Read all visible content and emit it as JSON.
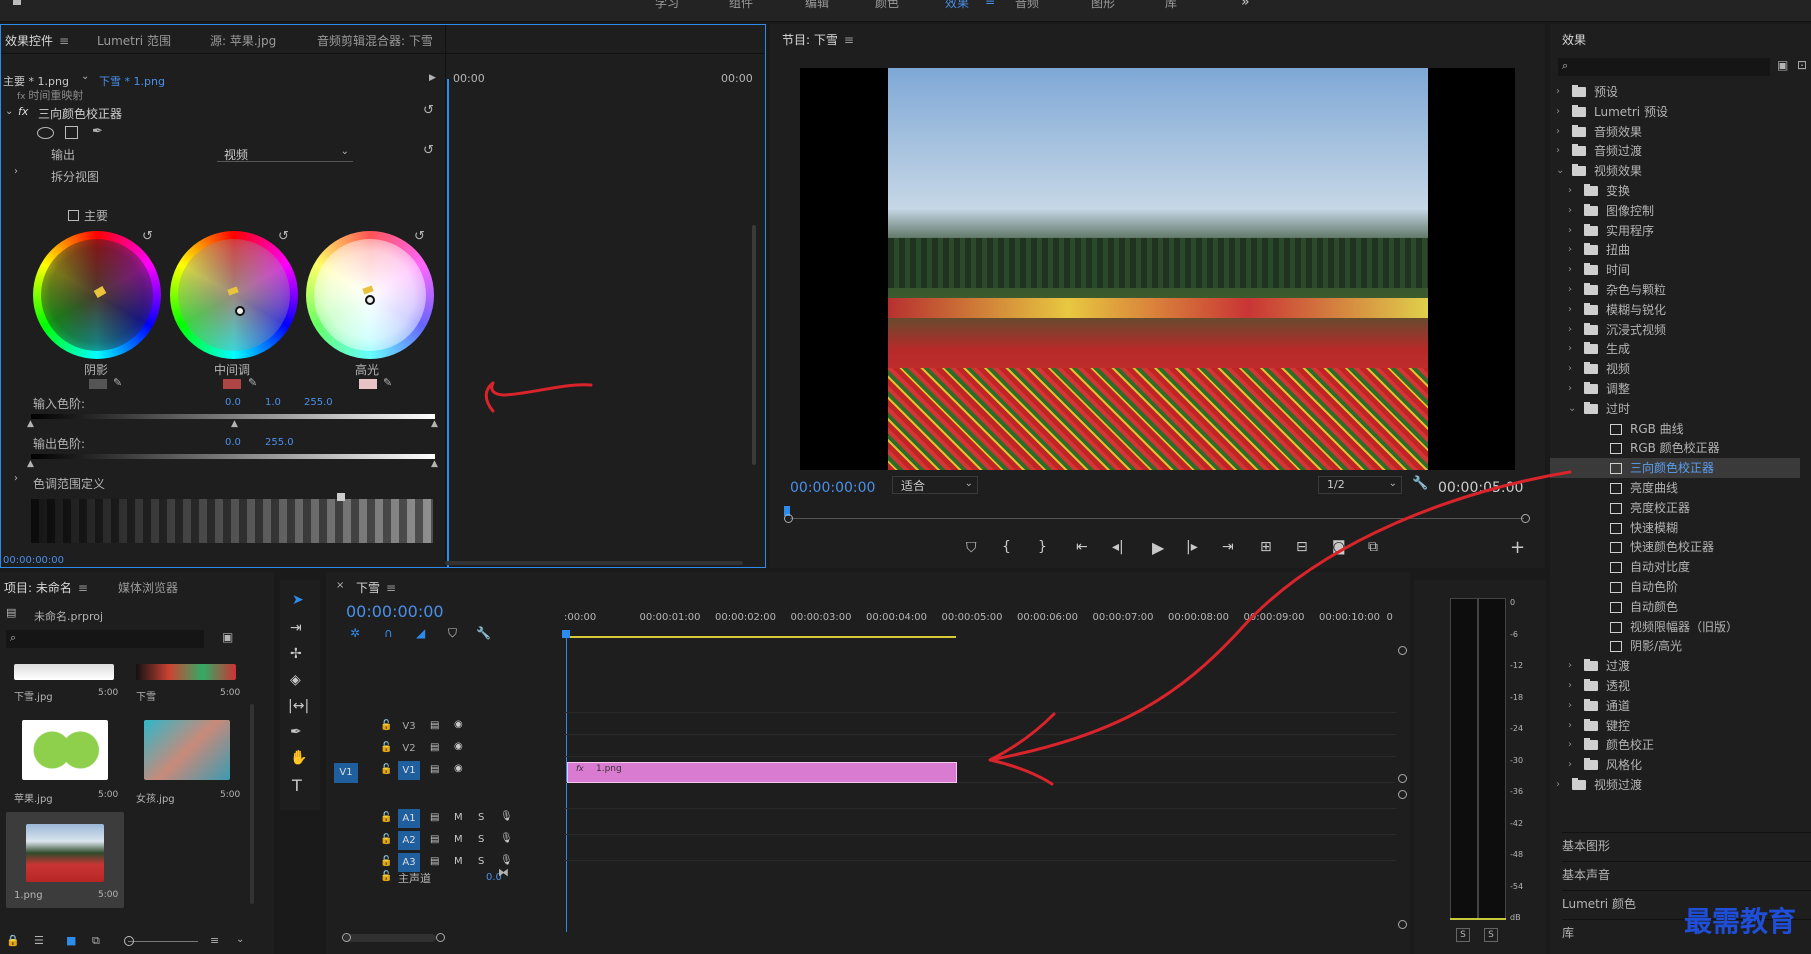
{
  "topbar": {
    "home_icon": "home-icon",
    "workspaces": [
      "学习",
      "组件",
      "编辑",
      "颜色",
      "效果",
      "音频",
      "图形",
      "库"
    ],
    "active_workspace": "效果",
    "more": "»"
  },
  "effect_controls": {
    "tabs": [
      "效果控件",
      "Lumetri 范围",
      "源: 苹果.jpg",
      "音频剪辑混合器: 下雪"
    ],
    "clip_master": "主要 * 1.png",
    "clip_seq": "下雪 * 1.png",
    "time_start": "00:00",
    "time_end": "00:00",
    "cut_row": "时间重映射",
    "effect_name": "三向颜色校正器",
    "output_label": "输出",
    "output_value": "视频",
    "split_view": "拆分视图",
    "master_checkbox": "主要",
    "wheels": [
      {
        "label": "阴影",
        "swatch": "#555555"
      },
      {
        "label": "中间调",
        "swatch": "#b04545"
      },
      {
        "label": "高光",
        "swatch": "#e8c4c4"
      }
    ],
    "input_levels_label": "输入色阶:",
    "input_levels": [
      "0.0",
      "1.0",
      "255.0"
    ],
    "output_levels_label": "输出色阶:",
    "output_levels": [
      "0.0",
      "255.0"
    ],
    "tonal_range": "色调范围定义",
    "timecode": "00:00:00:00"
  },
  "program": {
    "title": "节目: 下雪",
    "timecode": "00:00:00:00",
    "fit": "适合",
    "resolution": "1/2",
    "duration": "00:00:05:00"
  },
  "effects_panel": {
    "title": "效果",
    "search_placeholder": "",
    "items": [
      {
        "label": "预设",
        "level": 0,
        "type": "folder",
        "open": false
      },
      {
        "label": "Lumetri 预设",
        "level": 0,
        "type": "folder",
        "open": false
      },
      {
        "label": "音频效果",
        "level": 0,
        "type": "folder",
        "open": false
      },
      {
        "label": "音频过渡",
        "level": 0,
        "type": "folder",
        "open": false
      },
      {
        "label": "视频效果",
        "level": 0,
        "type": "folder",
        "open": true
      },
      {
        "label": "变换",
        "level": 1,
        "type": "folder",
        "open": false
      },
      {
        "label": "图像控制",
        "level": 1,
        "type": "folder",
        "open": false
      },
      {
        "label": "实用程序",
        "level": 1,
        "type": "folder",
        "open": false
      },
      {
        "label": "扭曲",
        "level": 1,
        "type": "folder",
        "open": false
      },
      {
        "label": "时间",
        "level": 1,
        "type": "folder",
        "open": false
      },
      {
        "label": "杂色与颗粒",
        "level": 1,
        "type": "folder",
        "open": false
      },
      {
        "label": "模糊与锐化",
        "level": 1,
        "type": "folder",
        "open": false
      },
      {
        "label": "沉浸式视频",
        "level": 1,
        "type": "folder",
        "open": false
      },
      {
        "label": "生成",
        "level": 1,
        "type": "folder",
        "open": false
      },
      {
        "label": "视频",
        "level": 1,
        "type": "folder",
        "open": false
      },
      {
        "label": "调整",
        "level": 1,
        "type": "folder",
        "open": false
      },
      {
        "label": "过时",
        "level": 1,
        "type": "folder",
        "open": true
      },
      {
        "label": "RGB 曲线",
        "level": 2,
        "type": "fx"
      },
      {
        "label": "RGB 颜色校正器",
        "level": 2,
        "type": "fx"
      },
      {
        "label": "三向颜色校正器",
        "level": 2,
        "type": "fx",
        "selected": true
      },
      {
        "label": "亮度曲线",
        "level": 2,
        "type": "fx"
      },
      {
        "label": "亮度校正器",
        "level": 2,
        "type": "fx"
      },
      {
        "label": "快速模糊",
        "level": 2,
        "type": "fx"
      },
      {
        "label": "快速颜色校正器",
        "level": 2,
        "type": "fx"
      },
      {
        "label": "自动对比度",
        "level": 2,
        "type": "fx"
      },
      {
        "label": "自动色阶",
        "level": 2,
        "type": "fx"
      },
      {
        "label": "自动颜色",
        "level": 2,
        "type": "fx"
      },
      {
        "label": "视频限幅器（旧版）",
        "level": 2,
        "type": "fx"
      },
      {
        "label": "阴影/高光",
        "level": 2,
        "type": "fx"
      },
      {
        "label": "过渡",
        "level": 1,
        "type": "folder",
        "open": false
      },
      {
        "label": "透视",
        "level": 1,
        "type": "folder",
        "open": false
      },
      {
        "label": "通道",
        "level": 1,
        "type": "folder",
        "open": false
      },
      {
        "label": "键控",
        "level": 1,
        "type": "folder",
        "open": false
      },
      {
        "label": "颜色校正",
        "level": 1,
        "type": "folder",
        "open": false
      },
      {
        "label": "风格化",
        "level": 1,
        "type": "folder",
        "open": false
      },
      {
        "label": "视频过渡",
        "level": 0,
        "type": "folder",
        "open": false
      }
    ],
    "bottom_panels": [
      "基本图形",
      "基本声音",
      "Lumetri 颜色",
      "库"
    ]
  },
  "project": {
    "tabs": [
      "项目: 未命名",
      "媒体浏览器"
    ],
    "file": "未命名.prproj",
    "items": [
      {
        "name": "下雪.jpg",
        "duration": "5:00"
      },
      {
        "name": "下雪",
        "duration": "5:00"
      },
      {
        "name": "苹果.jpg",
        "duration": "5:00"
      },
      {
        "name": "女孩.jpg",
        "duration": "5:00"
      },
      {
        "name": "1.png",
        "duration": "5:00"
      }
    ]
  },
  "timeline": {
    "title": "下雪",
    "timecode": "00:00:00:00",
    "ruler": [
      ":00:00",
      "00:00:01:00",
      "00:00:02:00",
      "00:00:03:00",
      "00:00:04:00",
      "00:00:05:00",
      "00:00:06:00",
      "00:00:07:00",
      "00:00:08:00",
      "00:00:09:00",
      "00:00:10:00",
      "0"
    ],
    "video_tracks": [
      "V3",
      "V2",
      "V1"
    ],
    "audio_tracks": [
      "A1",
      "A2",
      "A3"
    ],
    "source_v1": "V1",
    "master": "主声道",
    "master_value": "0.0",
    "clip_name": "1.png",
    "m_label": "M",
    "s_label": "S"
  },
  "meter": {
    "scale": [
      "0",
      "-6",
      "-12",
      "-18",
      "-24",
      "-30",
      "-36",
      "-42",
      "-48",
      "-54",
      "dB"
    ],
    "solo": [
      "S",
      "S"
    ]
  },
  "watermark": "最需教育"
}
